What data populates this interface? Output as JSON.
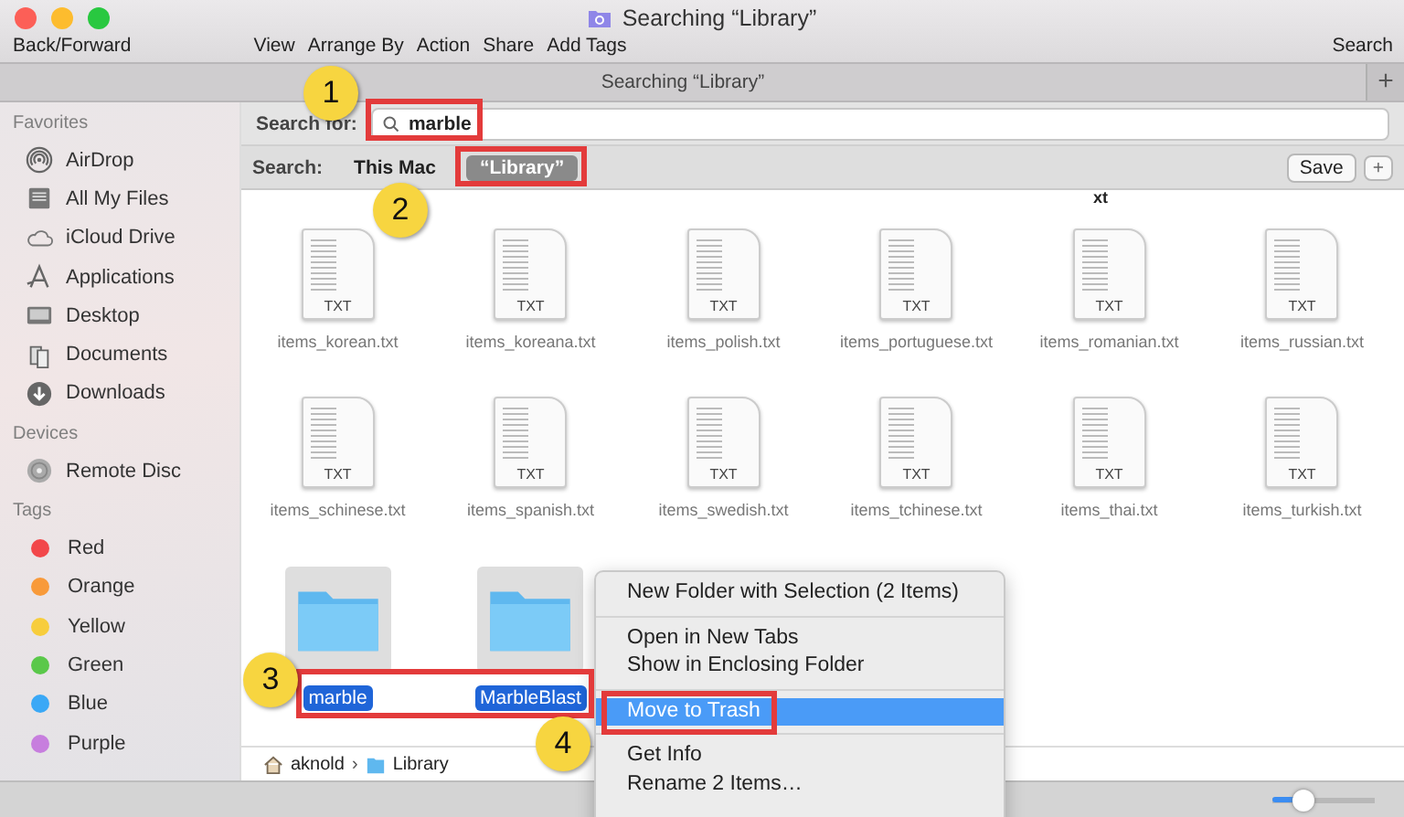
{
  "window": {
    "title": "Searching “Library”"
  },
  "toolbar": {
    "navigation": "Back/Forward",
    "items": [
      "View",
      "Arrange By",
      "Action",
      "Share",
      "Add Tags"
    ],
    "search": "Search"
  },
  "tab_bar": {
    "title": "Searching “Library”",
    "add": "+"
  },
  "sidebar": {
    "sections": [
      {
        "heading": "Favorites",
        "items": [
          {
            "label": "AirDrop"
          },
          {
            "label": "All My Files"
          },
          {
            "label": "iCloud Drive"
          },
          {
            "label": "Applications"
          },
          {
            "label": "Desktop"
          },
          {
            "label": "Documents"
          },
          {
            "label": "Downloads"
          }
        ]
      },
      {
        "heading": "Devices",
        "items": [
          {
            "label": "Remote Disc"
          }
        ]
      },
      {
        "heading": "Tags",
        "items": [
          {
            "label": "Red",
            "color": "#f2474a"
          },
          {
            "label": "Orange",
            "color": "#f89a3a"
          },
          {
            "label": "Yellow",
            "color": "#f7cd3c"
          },
          {
            "label": "Green",
            "color": "#5ac84a"
          },
          {
            "label": "Blue",
            "color": "#3aa8f6"
          },
          {
            "label": "Purple",
            "color": "#c77ede"
          }
        ]
      }
    ]
  },
  "search_bar": {
    "label": "Search for:",
    "value": "marble"
  },
  "scope_bar": {
    "label": "Search:",
    "options": [
      {
        "label": "This Mac",
        "selected": false
      },
      {
        "label": "“Library”",
        "selected": true
      }
    ],
    "save": "Save",
    "add": "+"
  },
  "results": {
    "cut_label": "xt",
    "files": [
      {
        "name": "items_korean.txt",
        "type": "TXT"
      },
      {
        "name": "items_koreana.txt",
        "type": "TXT"
      },
      {
        "name": "items_polish.txt",
        "type": "TXT"
      },
      {
        "name": "items_portuguese.txt",
        "type": "TXT"
      },
      {
        "name": "items_romanian.txt",
        "type": "TXT"
      },
      {
        "name": "items_russian.txt",
        "type": "TXT"
      },
      {
        "name": "items_schinese.txt",
        "type": "TXT"
      },
      {
        "name": "items_spanish.txt",
        "type": "TXT"
      },
      {
        "name": "items_swedish.txt",
        "type": "TXT"
      },
      {
        "name": "items_tchinese.txt",
        "type": "TXT"
      },
      {
        "name": "items_thai.txt",
        "type": "TXT"
      },
      {
        "name": "items_turkish.txt",
        "type": "TXT"
      }
    ],
    "folders": [
      {
        "name": "marble",
        "selected": true
      },
      {
        "name": "MarbleBlast",
        "selected": true
      }
    ]
  },
  "path_bar": [
    {
      "label": "aknold"
    },
    {
      "label": "Library"
    }
  ],
  "path_separator": "›",
  "context_menu": [
    [
      {
        "label": "New Folder with Selection (2 Items)",
        "highlighted": false
      }
    ],
    [
      {
        "label": "Open in New Tabs",
        "highlighted": false
      },
      {
        "label": "Show in Enclosing Folder",
        "highlighted": false
      }
    ],
    [
      {
        "label": "Move to Trash",
        "highlighted": true
      }
    ],
    [
      {
        "label": "Get Info",
        "highlighted": false
      },
      {
        "label": "Rename 2 Items…",
        "highlighted": false
      }
    ]
  ],
  "status_bar": {
    "zoom_slider": {
      "level": 0.3
    }
  },
  "callouts": [
    "1",
    "2",
    "3",
    "4"
  ]
}
